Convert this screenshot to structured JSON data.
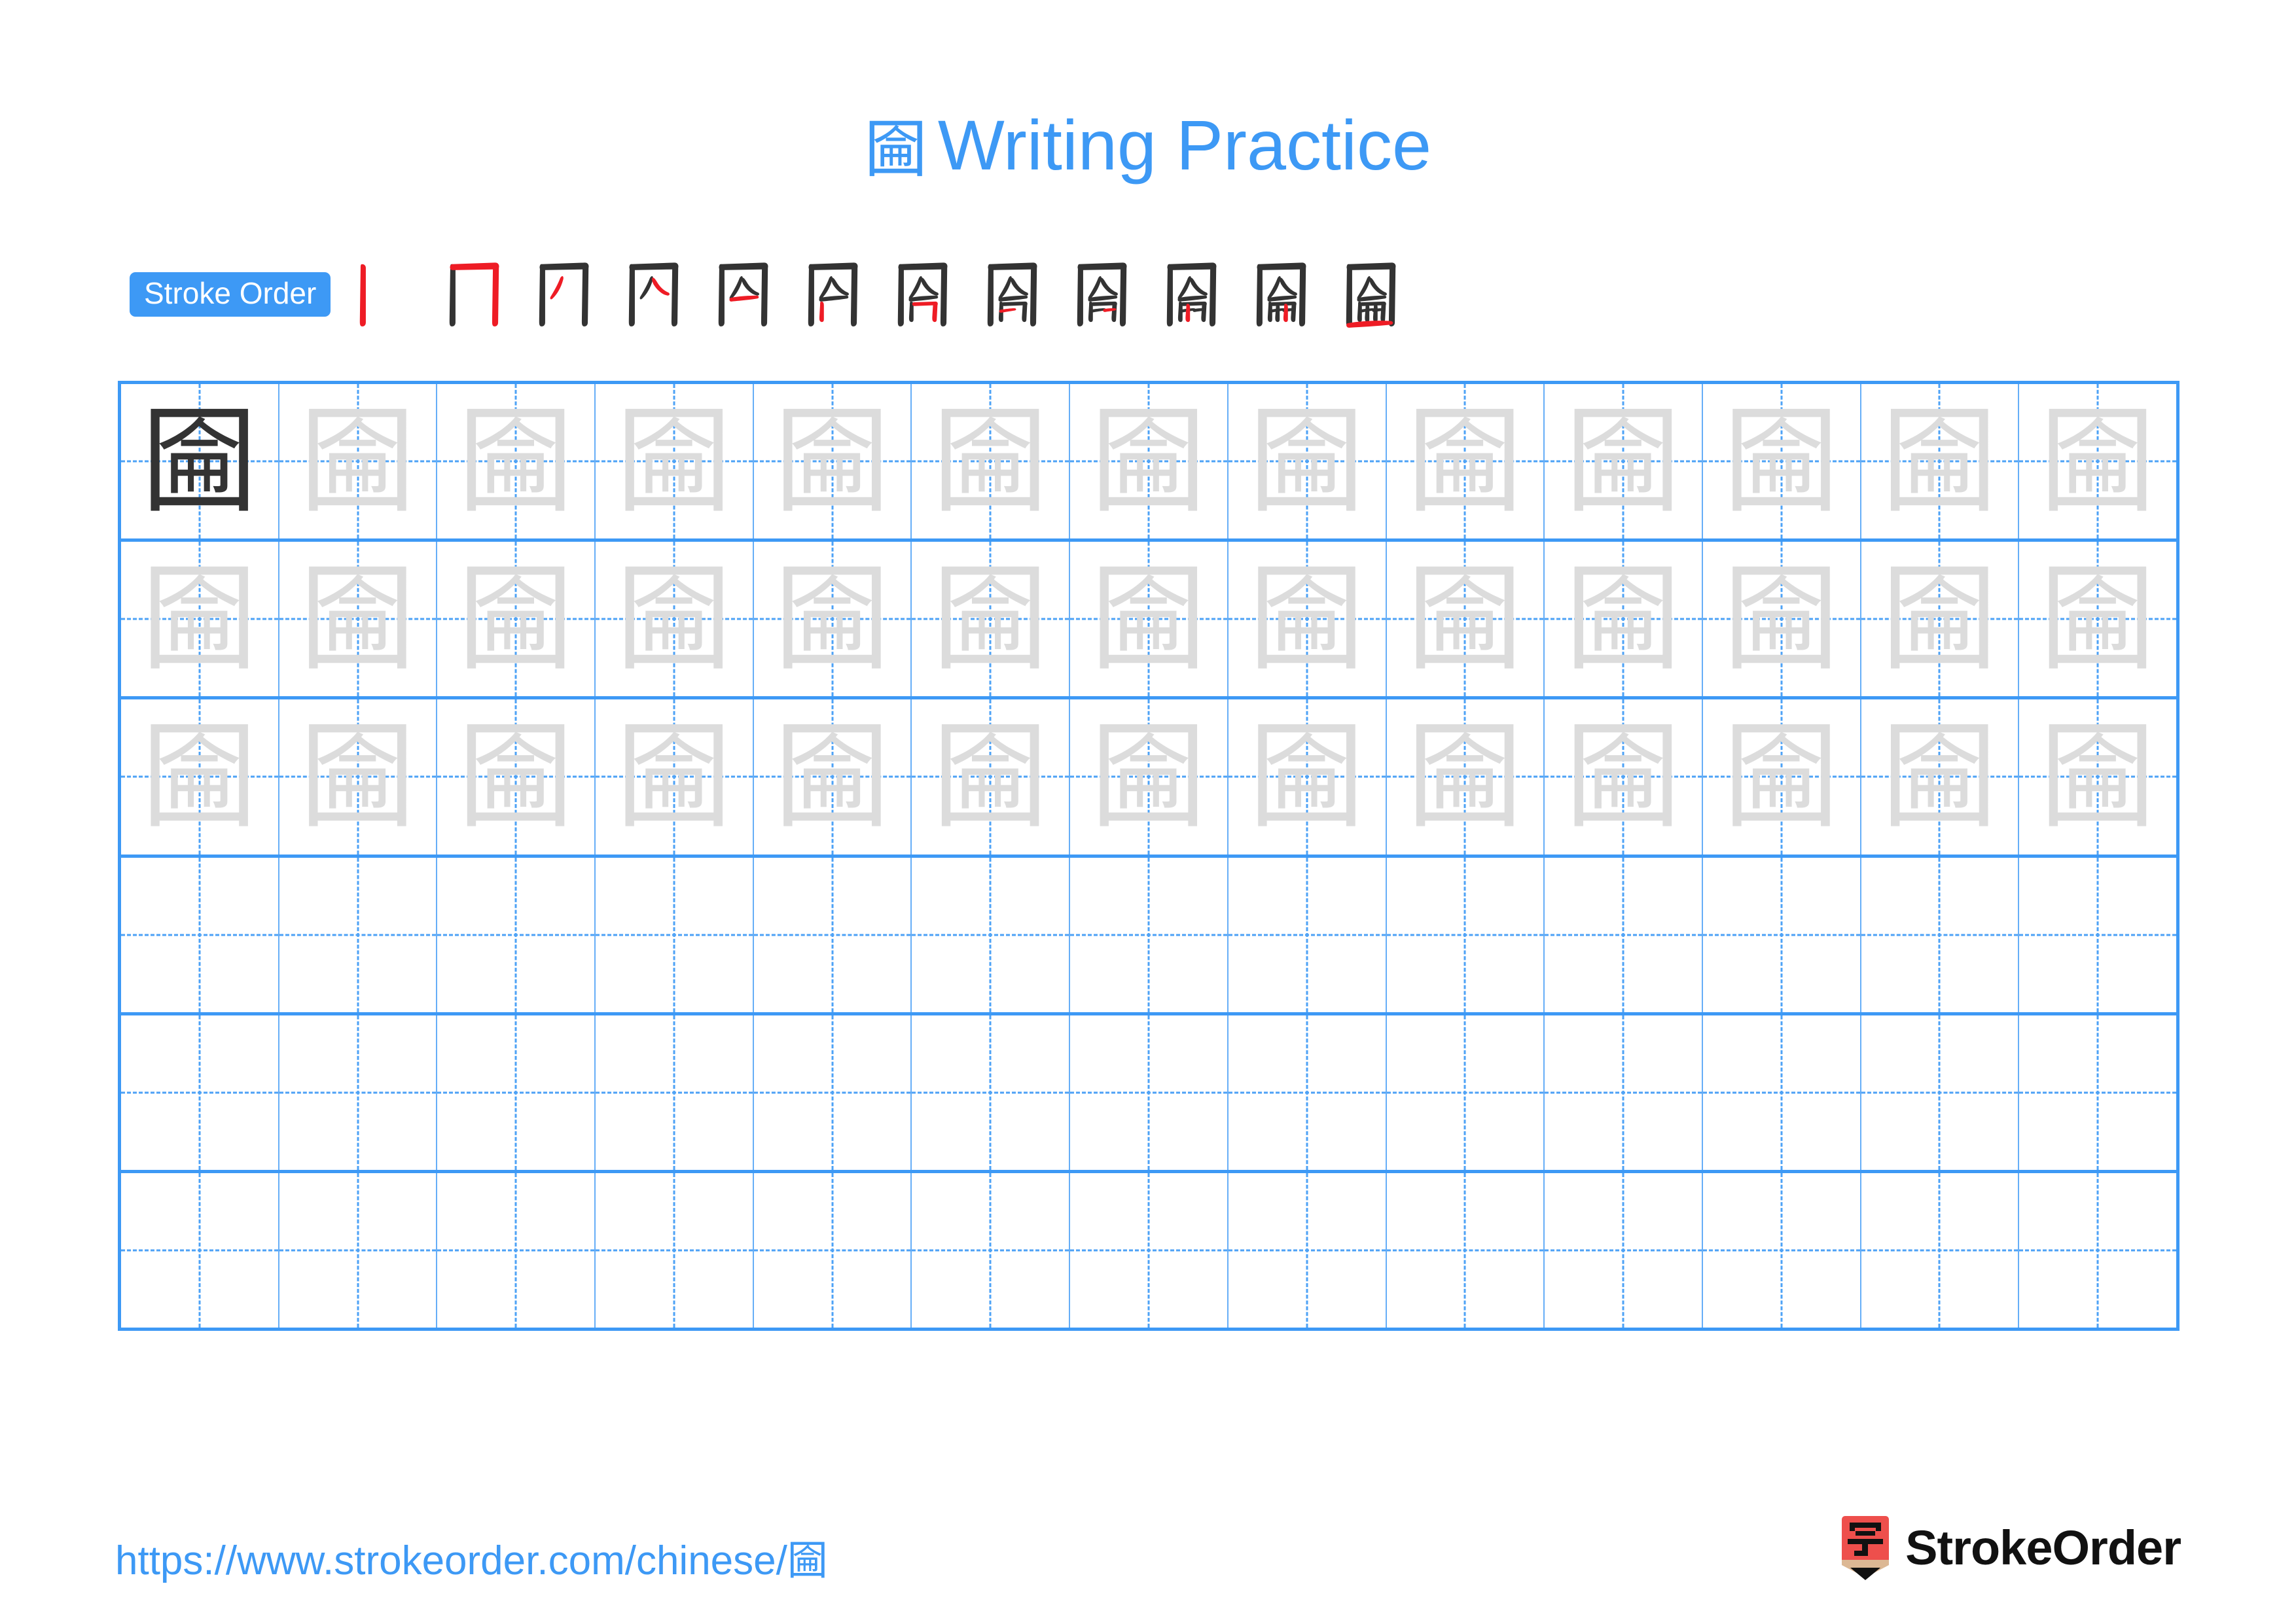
{
  "page": {
    "character": "圇",
    "background_color": "#ffffff",
    "accent_color": "#3d99f5",
    "grid_line_color": "#3d99f5",
    "grid_inner_line_color": "#66aef7",
    "trace_char_color": "#dcdcdc",
    "model_char_color": "#333333",
    "stroke_done_color": "#333333",
    "stroke_new_color": "#ee1c25"
  },
  "header": {
    "title_char": "圇",
    "title_text": "Writing Practice"
  },
  "stroke_order": {
    "badge_label": "Stroke Order",
    "total_strokes": 12,
    "steps": [
      {
        "index": 1,
        "new_stroke": "vertical (丨) left side of 囗"
      },
      {
        "index": 2,
        "new_stroke": "horizontal-turn-vertical (𠃍) top and right of 囗"
      },
      {
        "index": 3,
        "new_stroke": "slant-left (丿) inner top-left of 亼"
      },
      {
        "index": 4,
        "new_stroke": "slant-right (㇏) inner top-right of 亼"
      },
      {
        "index": 5,
        "new_stroke": "horizontal (一) under 亼"
      },
      {
        "index": 6,
        "new_stroke": "vertical (丨) inner left of 冊"
      },
      {
        "index": 7,
        "new_stroke": "horizontal-turn (𠃌) inner right of 冊"
      },
      {
        "index": 8,
        "new_stroke": "short horizontal (一) inner left bar"
      },
      {
        "index": 9,
        "new_stroke": "short horizontal (一) inner right bar"
      },
      {
        "index": 10,
        "new_stroke": "vertical (丨) inner center-left"
      },
      {
        "index": 11,
        "new_stroke": "vertical (丨) inner center-right"
      },
      {
        "index": 12,
        "new_stroke": "horizontal (一) closing bottom of 囗"
      }
    ]
  },
  "practice_grid": {
    "columns": 13,
    "rows": 6,
    "cells": [
      [
        "model",
        "trace",
        "trace",
        "trace",
        "trace",
        "trace",
        "trace",
        "trace",
        "trace",
        "trace",
        "trace",
        "trace",
        "trace"
      ],
      [
        "trace",
        "trace",
        "trace",
        "trace",
        "trace",
        "trace",
        "trace",
        "trace",
        "trace",
        "trace",
        "trace",
        "trace",
        "trace"
      ],
      [
        "trace",
        "trace",
        "trace",
        "trace",
        "trace",
        "trace",
        "trace",
        "trace",
        "trace",
        "trace",
        "trace",
        "trace",
        "trace"
      ],
      [
        "blank",
        "blank",
        "blank",
        "blank",
        "blank",
        "blank",
        "blank",
        "blank",
        "blank",
        "blank",
        "blank",
        "blank",
        "blank"
      ],
      [
        "blank",
        "blank",
        "blank",
        "blank",
        "blank",
        "blank",
        "blank",
        "blank",
        "blank",
        "blank",
        "blank",
        "blank",
        "blank"
      ],
      [
        "blank",
        "blank",
        "blank",
        "blank",
        "blank",
        "blank",
        "blank",
        "blank",
        "blank",
        "blank",
        "blank",
        "blank",
        "blank"
      ]
    ]
  },
  "footer": {
    "url_text": "https://www.strokeorder.com/chinese/圇",
    "brand_name": "StrokeOrder",
    "logo_char": "字",
    "logo_body_color": "#ee4f4c",
    "logo_wood_color": "#dcb894",
    "logo_tip_color": "#111111"
  }
}
